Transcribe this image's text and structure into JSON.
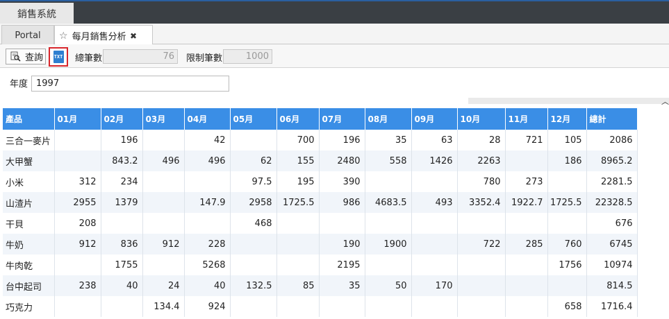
{
  "app": {
    "tab_label": "銷售系統"
  },
  "tabs": [
    {
      "label": "Portal"
    },
    {
      "label": "每月銷售分析"
    }
  ],
  "toolbar": {
    "query_label": "查詢",
    "txt_icon_text": "TXT",
    "total_label": "總筆數:",
    "total_value": "76",
    "limit_label": "限制筆數:",
    "limit_value": "1000"
  },
  "filter": {
    "year_label": "年度",
    "year_value": "1997"
  },
  "grid": {
    "headers": [
      "產品",
      "01月",
      "02月",
      "03月",
      "04月",
      "05月",
      "06月",
      "07月",
      "08月",
      "09月",
      "10月",
      "11月",
      "12月",
      "總計"
    ],
    "rows": [
      [
        "三合一麥片",
        "",
        "196",
        "",
        "42",
        "",
        "700",
        "196",
        "35",
        "63",
        "28",
        "721",
        "105",
        "2086"
      ],
      [
        "大甲蟹",
        "",
        "843.2",
        "496",
        "496",
        "62",
        "155",
        "2480",
        "558",
        "1426",
        "2263",
        "",
        "186",
        "8965.2"
      ],
      [
        "小米",
        "312",
        "234",
        "",
        "",
        "97.5",
        "195",
        "390",
        "",
        "",
        "780",
        "273",
        "",
        "2281.5"
      ],
      [
        "山渣片",
        "2955",
        "1379",
        "",
        "147.9",
        "2958",
        "1725.5",
        "986",
        "4683.5",
        "493",
        "3352.4",
        "1922.7",
        "1725.5",
        "22328.5"
      ],
      [
        "干貝",
        "208",
        "",
        "",
        "",
        "468",
        "",
        "",
        "",
        "",
        "",
        "",
        "",
        "676"
      ],
      [
        "牛奶",
        "912",
        "836",
        "912",
        "228",
        "",
        "",
        "190",
        "1900",
        "",
        "722",
        "285",
        "760",
        "6745"
      ],
      [
        "牛肉乾",
        "",
        "1755",
        "",
        "5268",
        "",
        "",
        "2195",
        "",
        "",
        "",
        "",
        "1756",
        "10974"
      ],
      [
        "台中起司",
        "238",
        "40",
        "24",
        "40",
        "132.5",
        "85",
        "35",
        "50",
        "170",
        "",
        "",
        "",
        "814.5"
      ],
      [
        "巧克力",
        "",
        "",
        "134.4",
        "924",
        "",
        "",
        "",
        "",
        "",
        "",
        "",
        "658",
        "1716.4"
      ]
    ]
  },
  "colors": {
    "header_bg": "#3a8ee6",
    "appbar_bg": "#3a3f44",
    "highlight_border": "#d8262b"
  }
}
